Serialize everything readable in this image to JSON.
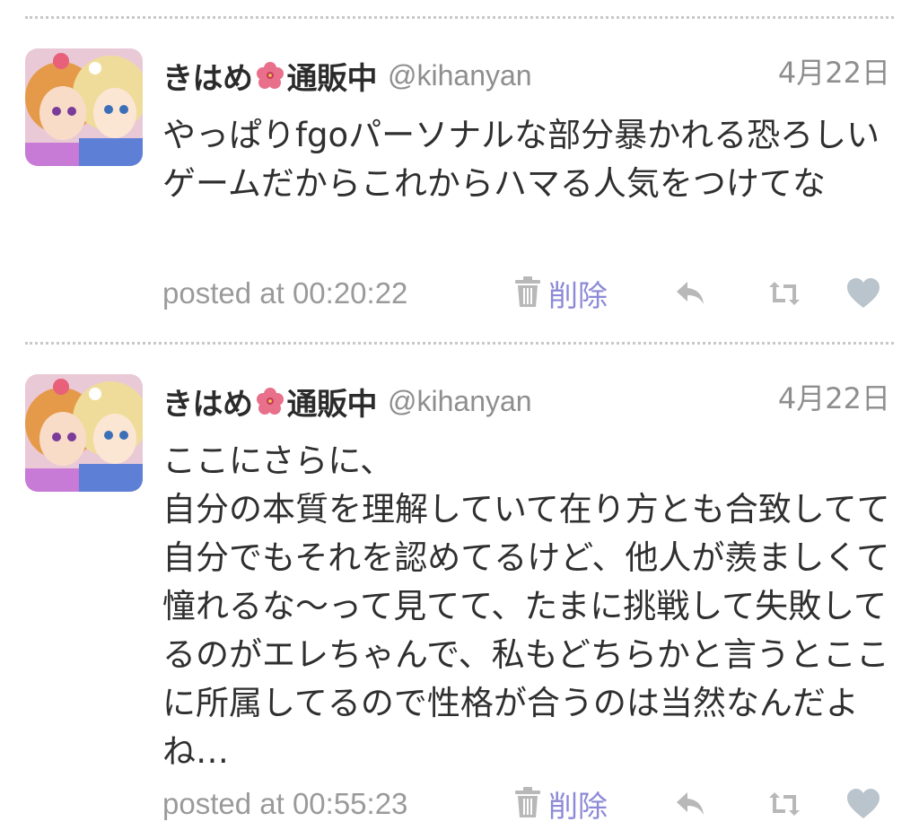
{
  "tweets": [
    {
      "user": {
        "name_before": "きはめ",
        "name_after": "通販中",
        "name_emoji": "hibiscus-icon",
        "handle": "@kihanyan"
      },
      "date": "4月22日",
      "text": "やっぱりfgoパーソナルな部分暴かれる恐ろしいゲームだからこれからハマる人気をつけてな",
      "posted": "posted at 00:20:22",
      "delete_label": "削除",
      "icons": {
        "trash": "trash-icon",
        "reply": "reply-icon",
        "retweet": "retweet-icon",
        "like": "heart-icon"
      }
    },
    {
      "user": {
        "name_before": "きはめ",
        "name_after": "通販中",
        "name_emoji": "hibiscus-icon",
        "handle": "@kihanyan"
      },
      "date": "4月22日",
      "text": "ここにさらに、\n自分の本質を理解していて在り方とも合致してて自分でもそれを認めてるけど、他人が羨ましくて憧れるな〜って見てて、たまに挑戦して失敗してるのがエレちゃんで、私もどちらかと言うとここに所属してるので性格が合うのは当然なんだよね…",
      "posted": "posted at 00:55:23",
      "delete_label": "削除",
      "icons": {
        "trash": "trash-icon",
        "reply": "reply-icon",
        "retweet": "retweet-icon",
        "like": "heart-icon"
      }
    }
  ],
  "colors": {
    "text": "#2f2f2f",
    "meta": "#9a9a9a",
    "delete": "#8c8ad6",
    "icon": "#b8b8b8",
    "heart": "#b9c4cc",
    "divider": "#c8c8c8"
  }
}
